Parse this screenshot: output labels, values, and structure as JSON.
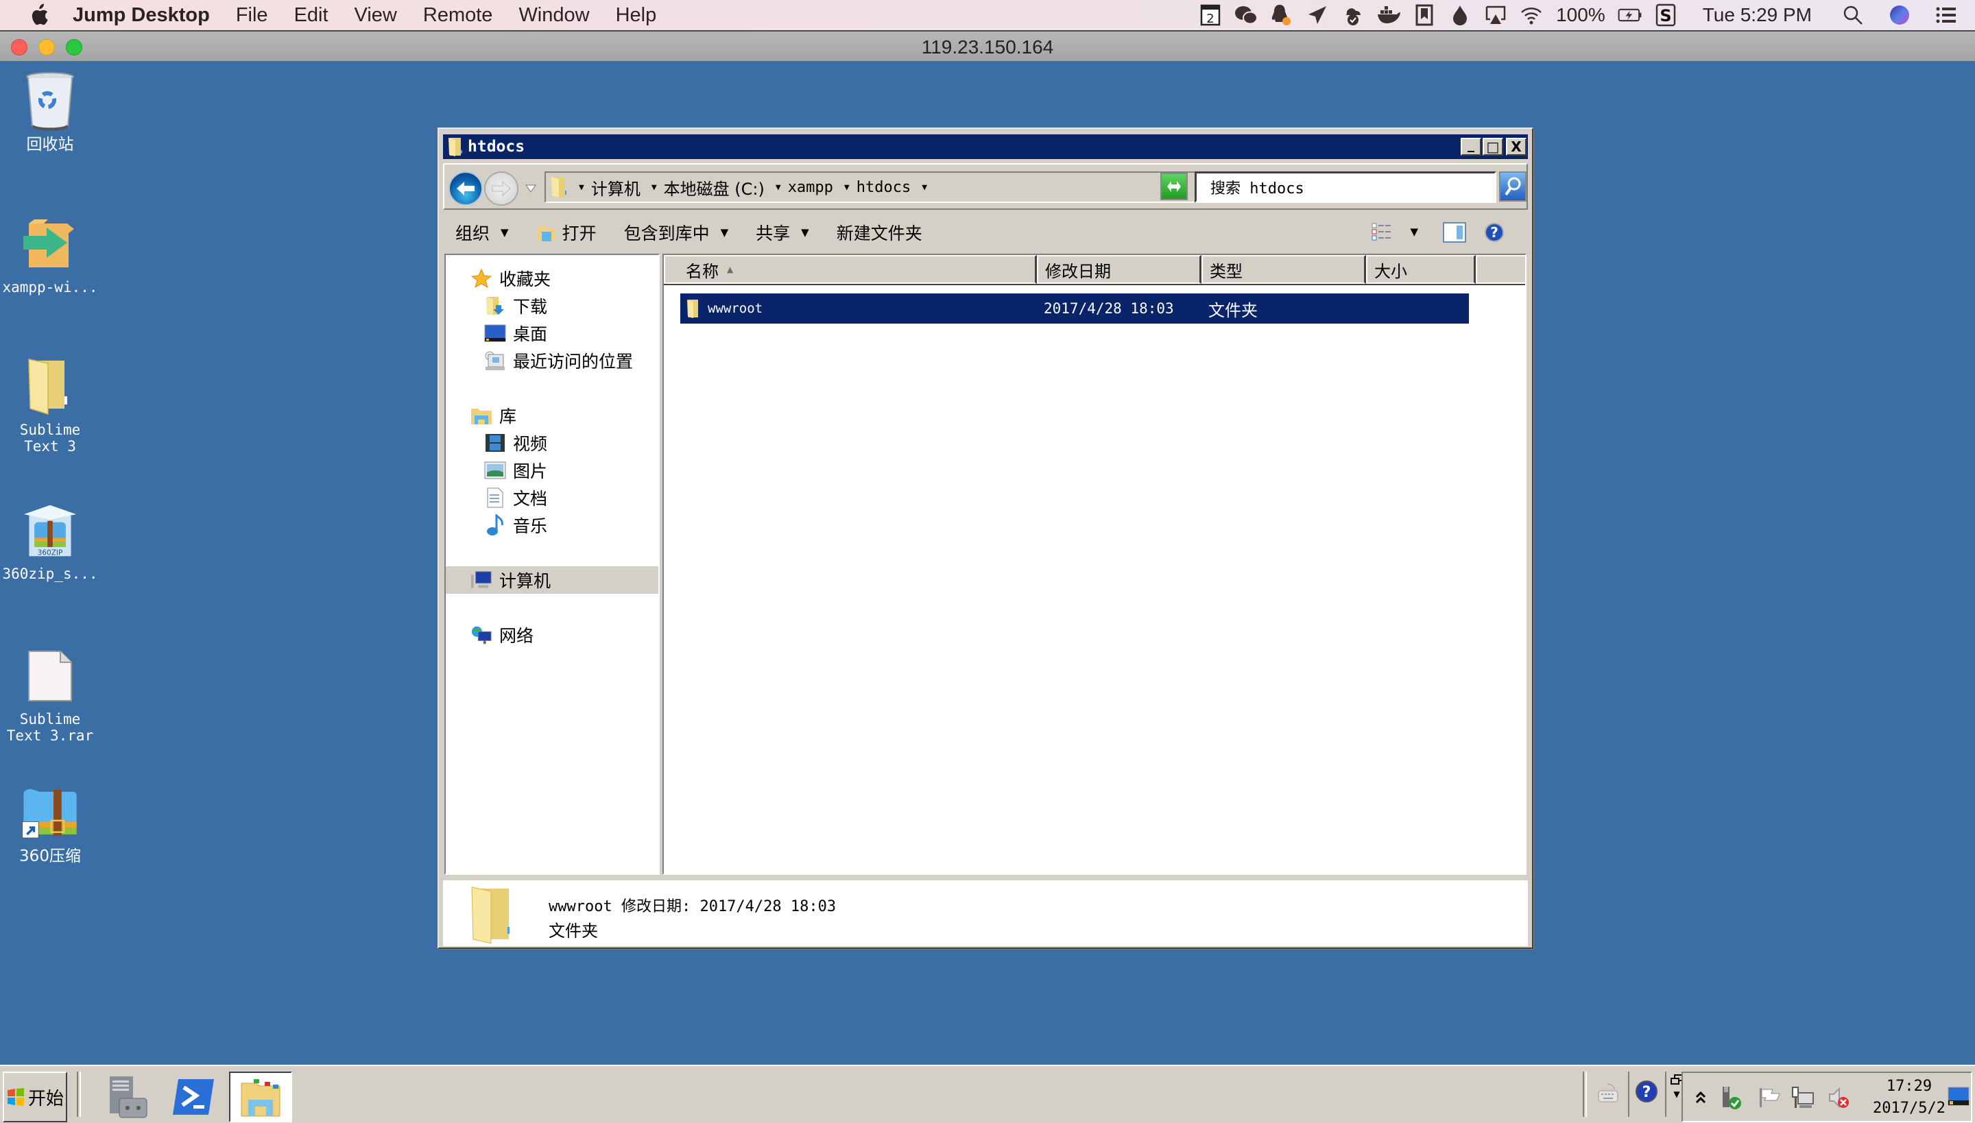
{
  "mac_menubar": {
    "app_name": "Jump Desktop",
    "menus": [
      "File",
      "Edit",
      "View",
      "Remote",
      "Window",
      "Help"
    ],
    "status": {
      "calendar_day": "2",
      "battery_percent": "100%",
      "clock": "Tue 5:29 PM"
    },
    "status_icons": [
      "calendar-icon",
      "wechat-icon",
      "qq-icon",
      "send-icon",
      "cloud-check-icon",
      "docker-icon",
      "bookmark-icon",
      "drop-icon",
      "airplay-icon",
      "wifi-icon",
      "battery-icon",
      "s-app-icon",
      "spotlight-icon",
      "siri-icon",
      "notification-center-icon"
    ]
  },
  "jump_window": {
    "title": "119.23.150.164"
  },
  "desktop": {
    "icons": [
      {
        "label": "回收站",
        "icon": "recycle-bin-icon"
      },
      {
        "label": "xampp-wi...",
        "icon": "installer-icon"
      },
      {
        "label": "Sublime Text 3",
        "icon": "folder-icon"
      },
      {
        "label": "360zip_s...",
        "icon": "360zip-installer-icon"
      },
      {
        "label": "Sublime Text 3.rar",
        "icon": "blank-file-icon"
      },
      {
        "label": "360压缩",
        "icon": "360zip-icon"
      }
    ]
  },
  "explorer": {
    "title": "htdocs",
    "window_buttons": {
      "minimize": "_",
      "maximize": "□",
      "close": "X"
    },
    "breadcrumb": [
      "计算机",
      "本地磁盘 (C:)",
      "xampp",
      "htdocs"
    ],
    "search_placeholder": "搜索 htdocs",
    "toolbar": {
      "organize": "组织",
      "open": "打开",
      "include_in_library": "包含到库中",
      "share": "共享",
      "new_folder": "新建文件夹"
    },
    "nav_pane": {
      "favorites": "收藏夹",
      "favorites_items": [
        "下载",
        "桌面",
        "最近访问的位置"
      ],
      "libraries": "库",
      "library_items": [
        "视频",
        "图片",
        "文档",
        "音乐"
      ],
      "computer": "计算机",
      "network": "网络"
    },
    "columns": [
      "名称",
      "修改日期",
      "类型",
      "大小"
    ],
    "files": [
      {
        "name": "wwwroot",
        "modified": "2017/4/28 18:03",
        "type": "文件夹",
        "size": ""
      }
    ],
    "details": {
      "line1": "wwwroot 修改日期: 2017/4/28 18:03",
      "line2": "文件夹"
    }
  },
  "taskbar": {
    "start_label": "开始",
    "clock_time": "17:29",
    "clock_date": "2017/5/2"
  },
  "colors": {
    "desktop_bg": "#3a6ea5",
    "title_bar": "#0a246a",
    "selection": "#0a246a",
    "window_face": "#d4d0c8"
  }
}
